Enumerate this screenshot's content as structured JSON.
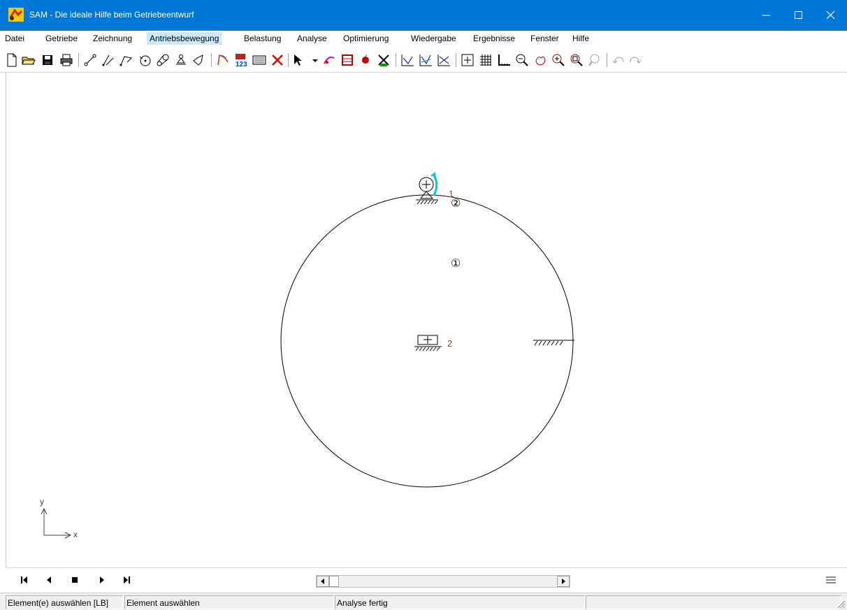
{
  "window": {
    "title": "SAM - Die ideale Hilfe beim Getriebeentwurf",
    "controls": [
      "minimize-icon",
      "maximize-icon",
      "close-icon"
    ]
  },
  "menu": {
    "items": [
      "Datei",
      "Getriebe",
      "Zeichnung",
      "Antriebsbewegung",
      "Belastung",
      "Analyse",
      "Optimierung",
      "Wiedergabe",
      "Ergebnisse",
      "Fenster",
      "Hilfe"
    ],
    "active": "Antriebsbewegung"
  },
  "toolbar": {
    "icons": [
      "new-file-icon",
      "open-folder-icon",
      "save-icon",
      "print-icon",
      "link-icon",
      "slider-link-icon",
      "triple-link-icon",
      "gear-icon",
      "belt-icon",
      "support-icon",
      "spring-icon",
      "motion-icon",
      "numbering-icon",
      "keyboard-icon",
      "delete-icon",
      "pointer-icon",
      "drive-icon",
      "load-icon",
      "point-icon",
      "mill-icon",
      "graph-icon",
      "graph2-icon",
      "graph3-icon",
      "grid-snap-icon",
      "grid-icon",
      "axis-icon",
      "zoom-out-icon",
      "pan-icon",
      "zoom-in-icon",
      "zoom-window-icon",
      "zoom-all-icon",
      "undo-icon",
      "redo-icon"
    ]
  },
  "canvas": {
    "node_labels": [
      "1",
      "2"
    ],
    "element_labels": [
      "②",
      "①"
    ],
    "axis": {
      "x": "x",
      "y": "y"
    },
    "colors": {
      "line": "#000000",
      "label": "#8b4513",
      "drive_arrow": "#00c8e0",
      "axis": "#404040"
    }
  },
  "playback": {
    "icons": [
      "first-frame-icon",
      "previous-frame-icon",
      "stop-icon",
      "next-frame-icon",
      "last-frame-icon"
    ],
    "scroll_position": 0
  },
  "status": {
    "pane1": "Element(e) auswählen [LB]",
    "pane2": "Element auswählen",
    "pane3": "Analyse fertig",
    "pane4": ""
  }
}
